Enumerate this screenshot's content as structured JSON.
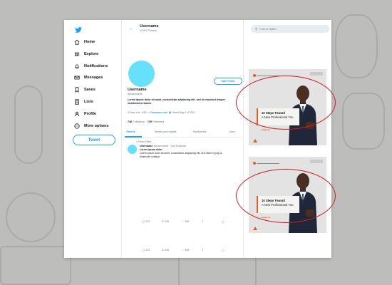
{
  "sidebar": {
    "items": [
      {
        "label": "Home",
        "icon": "home-icon"
      },
      {
        "label": "Explore",
        "icon": "hashtag-icon"
      },
      {
        "label": "Notifications",
        "icon": "bell-icon"
      },
      {
        "label": "Messages",
        "icon": "envelope-icon"
      },
      {
        "label": "Saves",
        "icon": "bookmark-icon"
      },
      {
        "label": "Lists",
        "icon": "list-icon"
      },
      {
        "label": "Profile",
        "icon": "person-icon"
      },
      {
        "label": "More options",
        "icon": "more-icon"
      }
    ],
    "tweet_button": "Tweet"
  },
  "header": {
    "title": "Username",
    "subtitle": "15.8% Tweets"
  },
  "profile": {
    "edit_button": "Edit Profile",
    "name": "Username",
    "handle": "@username",
    "bio": "Lorem ipsum dolor sit amet, consectetur adipiscing elit, sed do eiusmod tempor incididunt ut labore.",
    "location": "New York, USA",
    "website": "Yourname.com",
    "joined": "Joined May 4 of 2019",
    "following_count": "746",
    "following_label": "Following",
    "followers_count": "749",
    "followers_label": "Followers"
  },
  "tabs": [
    "Tweets",
    "Tweets and replies",
    "Multimedia",
    "Likes"
  ],
  "tweet": {
    "pinned_label": "Pinned Tweet",
    "name": "Username",
    "handle": "@username · tour 6 ab/ate",
    "line1": "Lorem ipsum dolor",
    "line2": "Lorem ipsum dolor sit amet, consectetur adipiscing elit, sed dhem of pig so",
    "line3": "eiusmode cowtpor",
    "actions": {
      "reply": "133",
      "retweet": "335",
      "like": "389"
    }
  },
  "tweet2_actions": {
    "reply": "133",
    "retweet": "335",
    "like": "389"
  },
  "search": {
    "placeholder": "Find in Twitter"
  },
  "ads": [
    {
      "line1": "10 Steps Toward",
      "line2": "A New Professional You",
      "small": "orange act"
    },
    {
      "line1": "10 Steps Toward",
      "line2": "A New Professional You",
      "small": "orange act"
    }
  ],
  "colors": {
    "accent": "#1da1f2",
    "avatar": "#66e0fb",
    "ad_accent": "#e85d1a",
    "highlight_ring": "#d11d1d"
  }
}
